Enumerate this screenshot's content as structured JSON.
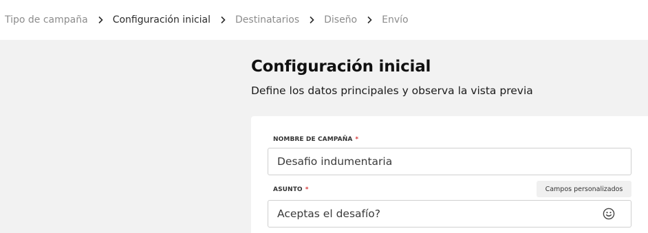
{
  "breadcrumb": {
    "steps": [
      {
        "label": "Tipo de campaña"
      },
      {
        "label": "Configuración inicial"
      },
      {
        "label": "Destinatarios"
      },
      {
        "label": "Diseño"
      },
      {
        "label": "Envío"
      }
    ],
    "active_index": 1
  },
  "page": {
    "title": "Configuración inicial",
    "subtitle": "Define los datos principales y observa la vista previa"
  },
  "form": {
    "campaign_name": {
      "label": "NOMBRE DE CAMPAÑA",
      "required_mark": "*",
      "value": "Desafio indumentaria"
    },
    "subject": {
      "label": "ASUNTO",
      "required_mark": "*",
      "value": "Aceptas el desafío?",
      "custom_fields_button": "Campos personalizados",
      "emoji_icon": "smiley-icon"
    }
  },
  "colors": {
    "required": "#d63a3a",
    "background": "#f2f2f2",
    "card": "#ffffff"
  }
}
